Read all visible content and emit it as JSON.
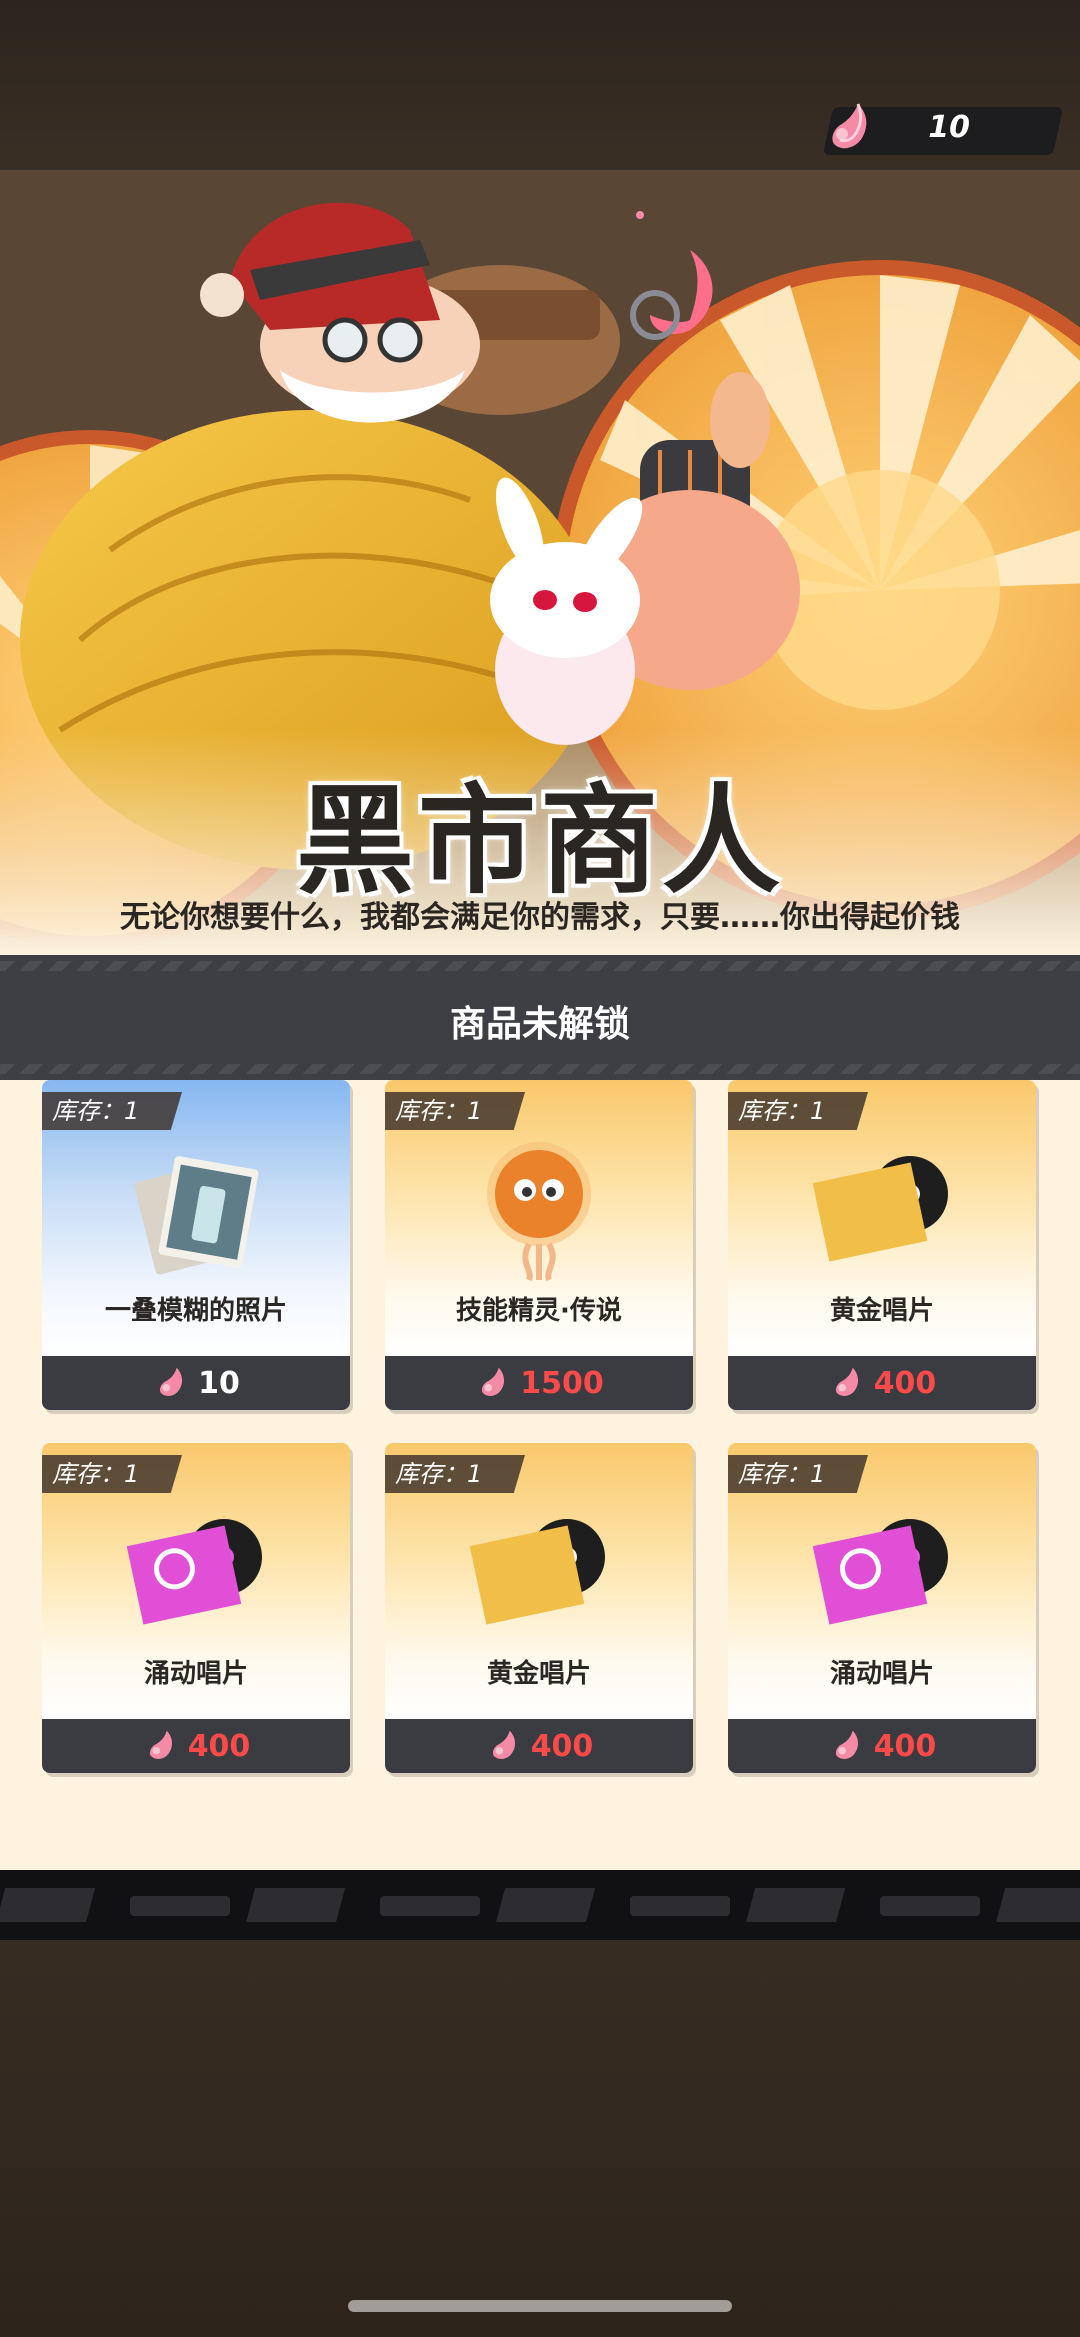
{
  "currency": {
    "amount": "10",
    "icon": "pink-crystal-icon"
  },
  "merchant": {
    "title": "黑市商人",
    "subtitle": "无论你想要什么，我都会满足你的需求，只要……你出得起价钱"
  },
  "lock_banner": {
    "text": "商品未解锁"
  },
  "items": [
    {
      "stock": "库存：1",
      "name": "一叠模糊的照片",
      "price": "10",
      "price_color": "#ffffff",
      "art": "photo-stack-icon",
      "bg": "blue"
    },
    {
      "stock": "库存：1",
      "name": "技能精灵·传说",
      "price": "1500",
      "price_color": "#ff4a4a",
      "art": "skill-sprite-icon",
      "bg": "gold"
    },
    {
      "stock": "库存：1",
      "name": "黄金唱片",
      "price": "400",
      "price_color": "#ff4a4a",
      "art": "gold-record-icon",
      "bg": "gold"
    },
    {
      "stock": "库存：1",
      "name": "涌动唱片",
      "price": "400",
      "price_color": "#ff4a4a",
      "art": "pulse-record-icon",
      "bg": "gold"
    },
    {
      "stock": "库存：1",
      "name": "黄金唱片",
      "price": "400",
      "price_color": "#ff4a4a",
      "art": "gold-record-icon",
      "bg": "gold"
    },
    {
      "stock": "库存：1",
      "name": "涌动唱片",
      "price": "400",
      "price_color": "#ff4a4a",
      "art": "pulse-record-icon",
      "bg": "gold"
    }
  ]
}
